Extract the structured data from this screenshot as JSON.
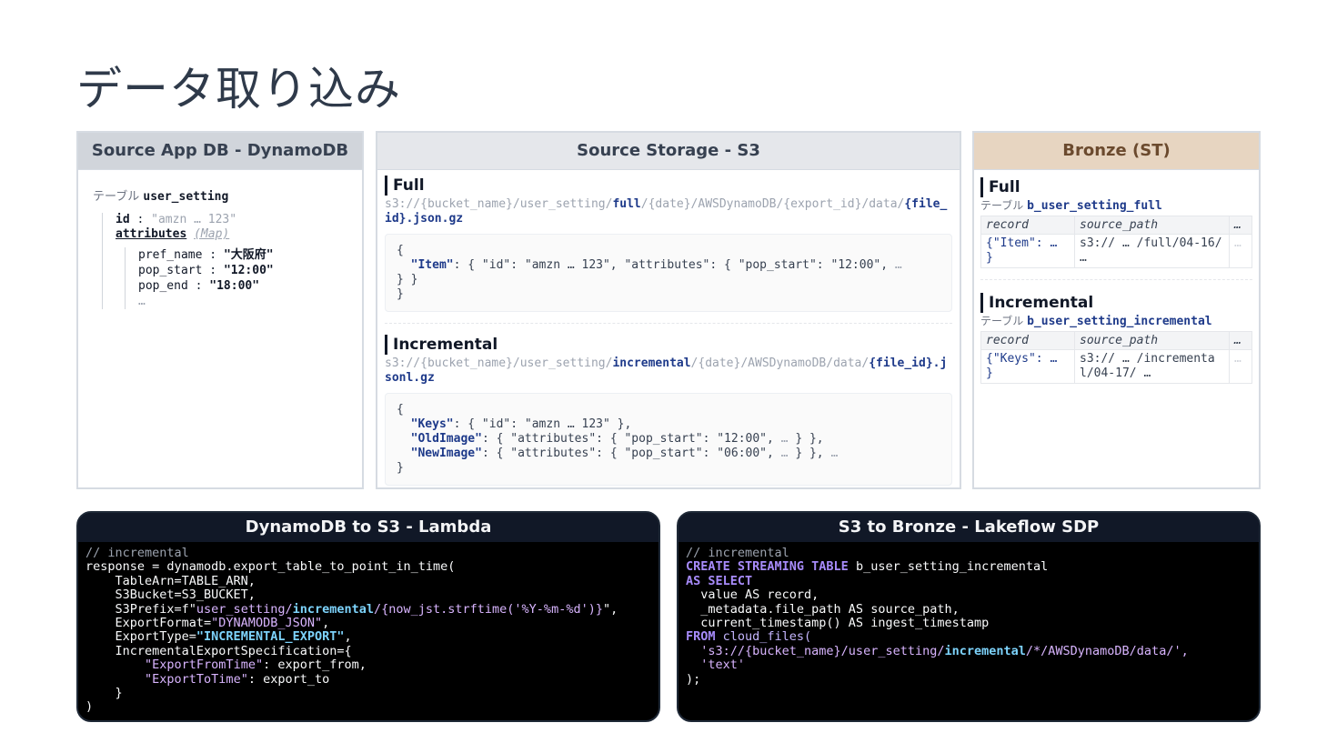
{
  "page": {
    "title": "データ取り込み"
  },
  "dynamo": {
    "header": "Source App DB - DynamoDB",
    "table_prefix": "テーブル",
    "table_name": "user_setting",
    "id_key": "id",
    "id_value": "\"amzn … 123\"",
    "attr_key": "attributes",
    "attr_type": "(Map)",
    "fields": [
      {
        "name": "pref_name",
        "value": "\"大阪府\""
      },
      {
        "name": "pop_start",
        "value": "\"12:00\""
      },
      {
        "name": "pop_end",
        "value": "\"18:00\""
      }
    ],
    "more": "…"
  },
  "s3": {
    "header": "Source Storage - S3",
    "full": {
      "title": "Full",
      "path_a": "s3://{bucket_name}/user_setting/",
      "path_hl1": "full",
      "path_b": "/{date}/AWSDynamoDB/{export_id}/data/",
      "path_hl2": "{file_id}.json.gz",
      "json_open": "{",
      "item_key": "\"Item\"",
      "item_rest": ": { \"id\": \"amzn … 123\", \"attributes\": { \"pop_start\": \"12:00\", ",
      "ellipsis": "…",
      "close1": "} }",
      "close2": "}"
    },
    "inc": {
      "title": "Incremental",
      "path_a": "s3://{bucket_name}/user_setting/",
      "path_hl1": "incremental",
      "path_b": "/{date}/AWSDynamoDB/data/",
      "path_hl2": "{file_id}.jsonl.gz",
      "json_open": "{",
      "keys_key": "\"Keys\"",
      "keys_rest": ": { \"id\": \"amzn … 123\" },",
      "old_key": "\"OldImage\"",
      "old_rest": ": { \"attributes\": { \"pop_start\": \"12:00\", ",
      "old_end": " } },",
      "new_key": "\"NewImage\"",
      "new_rest": ": { \"attributes\": { \"pop_start\": \"06:00\", ",
      "new_end": " } }, ",
      "ellipsis": "…",
      "close": "}"
    }
  },
  "bronze": {
    "header": "Bronze (ST)",
    "full": {
      "title": "Full",
      "prefix": "テーブル",
      "name_a": "b_user_setting_",
      "name_hl": "full",
      "col1": "record",
      "col2": "source_path",
      "col3": "…",
      "v1": "{\"Item\": … }",
      "v2": "s3:// … /full/04-16/ …",
      "v3": "…"
    },
    "inc": {
      "title": "Incremental",
      "prefix": "テーブル",
      "name_a": "b_user_setting_",
      "name_hl": "incremental",
      "col1": "record",
      "col2": "source_path",
      "col3": "…",
      "v1": "{\"Keys\": … }",
      "v2": "s3:// … /incremental/04-17/ …",
      "v3": "…"
    }
  },
  "lambda": {
    "header": "DynamoDB to S3 - Lambda",
    "l1": "// incremental",
    "l2": "response = dynamodb.export_table_to_point_in_time(",
    "l3": "    TableArn=TABLE_ARN,",
    "l4": "    S3Bucket=S3_BUCKET,",
    "l5a": "    S3Prefix=f\"",
    "l5b": "user_setting/",
    "l5c": "incremental",
    "l5d": "/{now_jst.strftime('%Y-%m-%d')}",
    "l5e": "\",",
    "l6a": "    ExportFormat=",
    "l6b": "\"DYNAMODB_JSON\"",
    "l6c": ",",
    "l7a": "    ExportType=",
    "l7b": "\"INCREMENTAL_EXPORT\"",
    "l7c": ",",
    "l8": "    IncrementalExportSpecification={",
    "l9a": "        ",
    "l9b": "\"ExportFromTime\"",
    "l9c": ": export_from,",
    "l10a": "        ",
    "l10b": "\"ExportToTime\"",
    "l10c": ": export_to",
    "l11": "    }",
    "l12": ")"
  },
  "sdp": {
    "header": "S3 to Bronze - Lakeflow SDP",
    "l1": "// incremental",
    "l2a": "CREATE STREAMING TABLE",
    "l2b": " b_user_setting_incremental",
    "l3": "AS SELECT",
    "l4": "  value AS record,",
    "l5": "  _metadata.file_path AS source_path,",
    "l6": "  current_timestamp() AS ingest_timestamp",
    "l7a": "FROM",
    "l7b": " cloud_files(",
    "l8a": "  's3://{bucket_name}/user_setting/",
    "l8b": "incremental",
    "l8c": "/*/AWSDynamoDB/data/',",
    "l9": "  'text'",
    "l10": ");"
  }
}
